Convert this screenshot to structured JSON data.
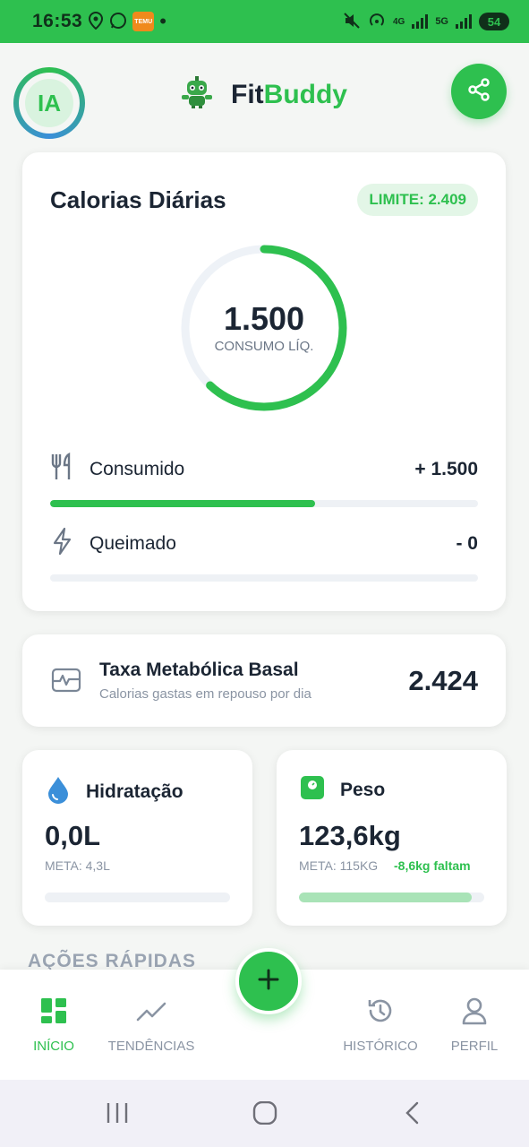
{
  "status_bar": {
    "time": "16:53",
    "temu_label": "TEMU",
    "network": "4G",
    "network2": "5G",
    "battery": "54"
  },
  "header": {
    "avatar_initials": "IA",
    "brand_part1": "Fit",
    "brand_part2": "Buddy",
    "brand_color": "#2ec04f"
  },
  "calories": {
    "title": "Calorias Diárias",
    "limit_label": "LIMITE: 2.409",
    "net_value": "1.500",
    "net_label": "CONSUMO LÍQ.",
    "ring_progress": 0.62,
    "consumed_label": "Consumido",
    "consumed_value": "+ 1.500",
    "consumed_progress": 0.62,
    "burned_label": "Queimado",
    "burned_value": "- 0",
    "burned_progress": 0
  },
  "tmb": {
    "title": "Taxa Metabólica Basal",
    "subtitle": "Calorias gastas em repouso por dia",
    "value": "2.424"
  },
  "hydration": {
    "title": "Hidratação",
    "value": "0,0L",
    "meta": "META: 4,3L",
    "progress": 0
  },
  "weight": {
    "title": "Peso",
    "value": "123,6kg",
    "meta": "META: 115KG",
    "remaining": "-8,6kg faltam",
    "progress": 0.93
  },
  "quick_actions_title": "AÇÕES RÁPIDAS",
  "bottom_nav": {
    "home": "INÍCIO",
    "trends": "TENDÊNCIAS",
    "history": "HISTÓRICO",
    "profile": "PERFIL"
  }
}
